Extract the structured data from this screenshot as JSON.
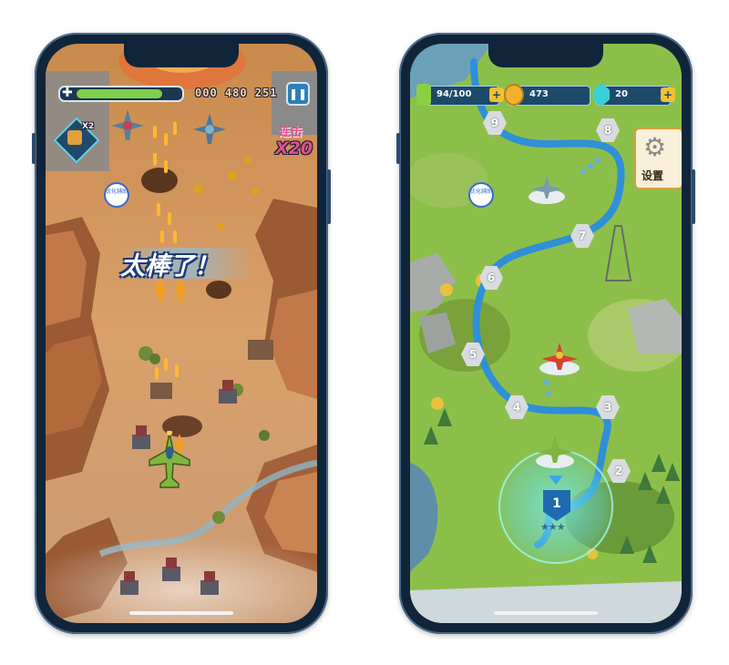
{
  "game_screen": {
    "score": "000 480 251",
    "multiplier": "X2",
    "combo_label": "连击",
    "combo_value": "X20",
    "praise_text": "太棒了！",
    "watermark": "优化辅助",
    "health_fraction": 0.85,
    "colors": {
      "health": "#7ed04a",
      "combo": "#e0508a",
      "praise": "#ffffff"
    }
  },
  "map_screen": {
    "energy": "94/100",
    "coins": "473",
    "gems": "20",
    "settings_label": "设置",
    "watermark": "优化辅助",
    "levels": [
      "1",
      "2",
      "3",
      "4",
      "5",
      "6",
      "7",
      "8",
      "9"
    ],
    "current_level": "1",
    "current_level_stars": 3,
    "colors": {
      "path": "#2f8fd8",
      "terrain": "#8cbf4a",
      "highlight": "#7ff0f0"
    }
  }
}
